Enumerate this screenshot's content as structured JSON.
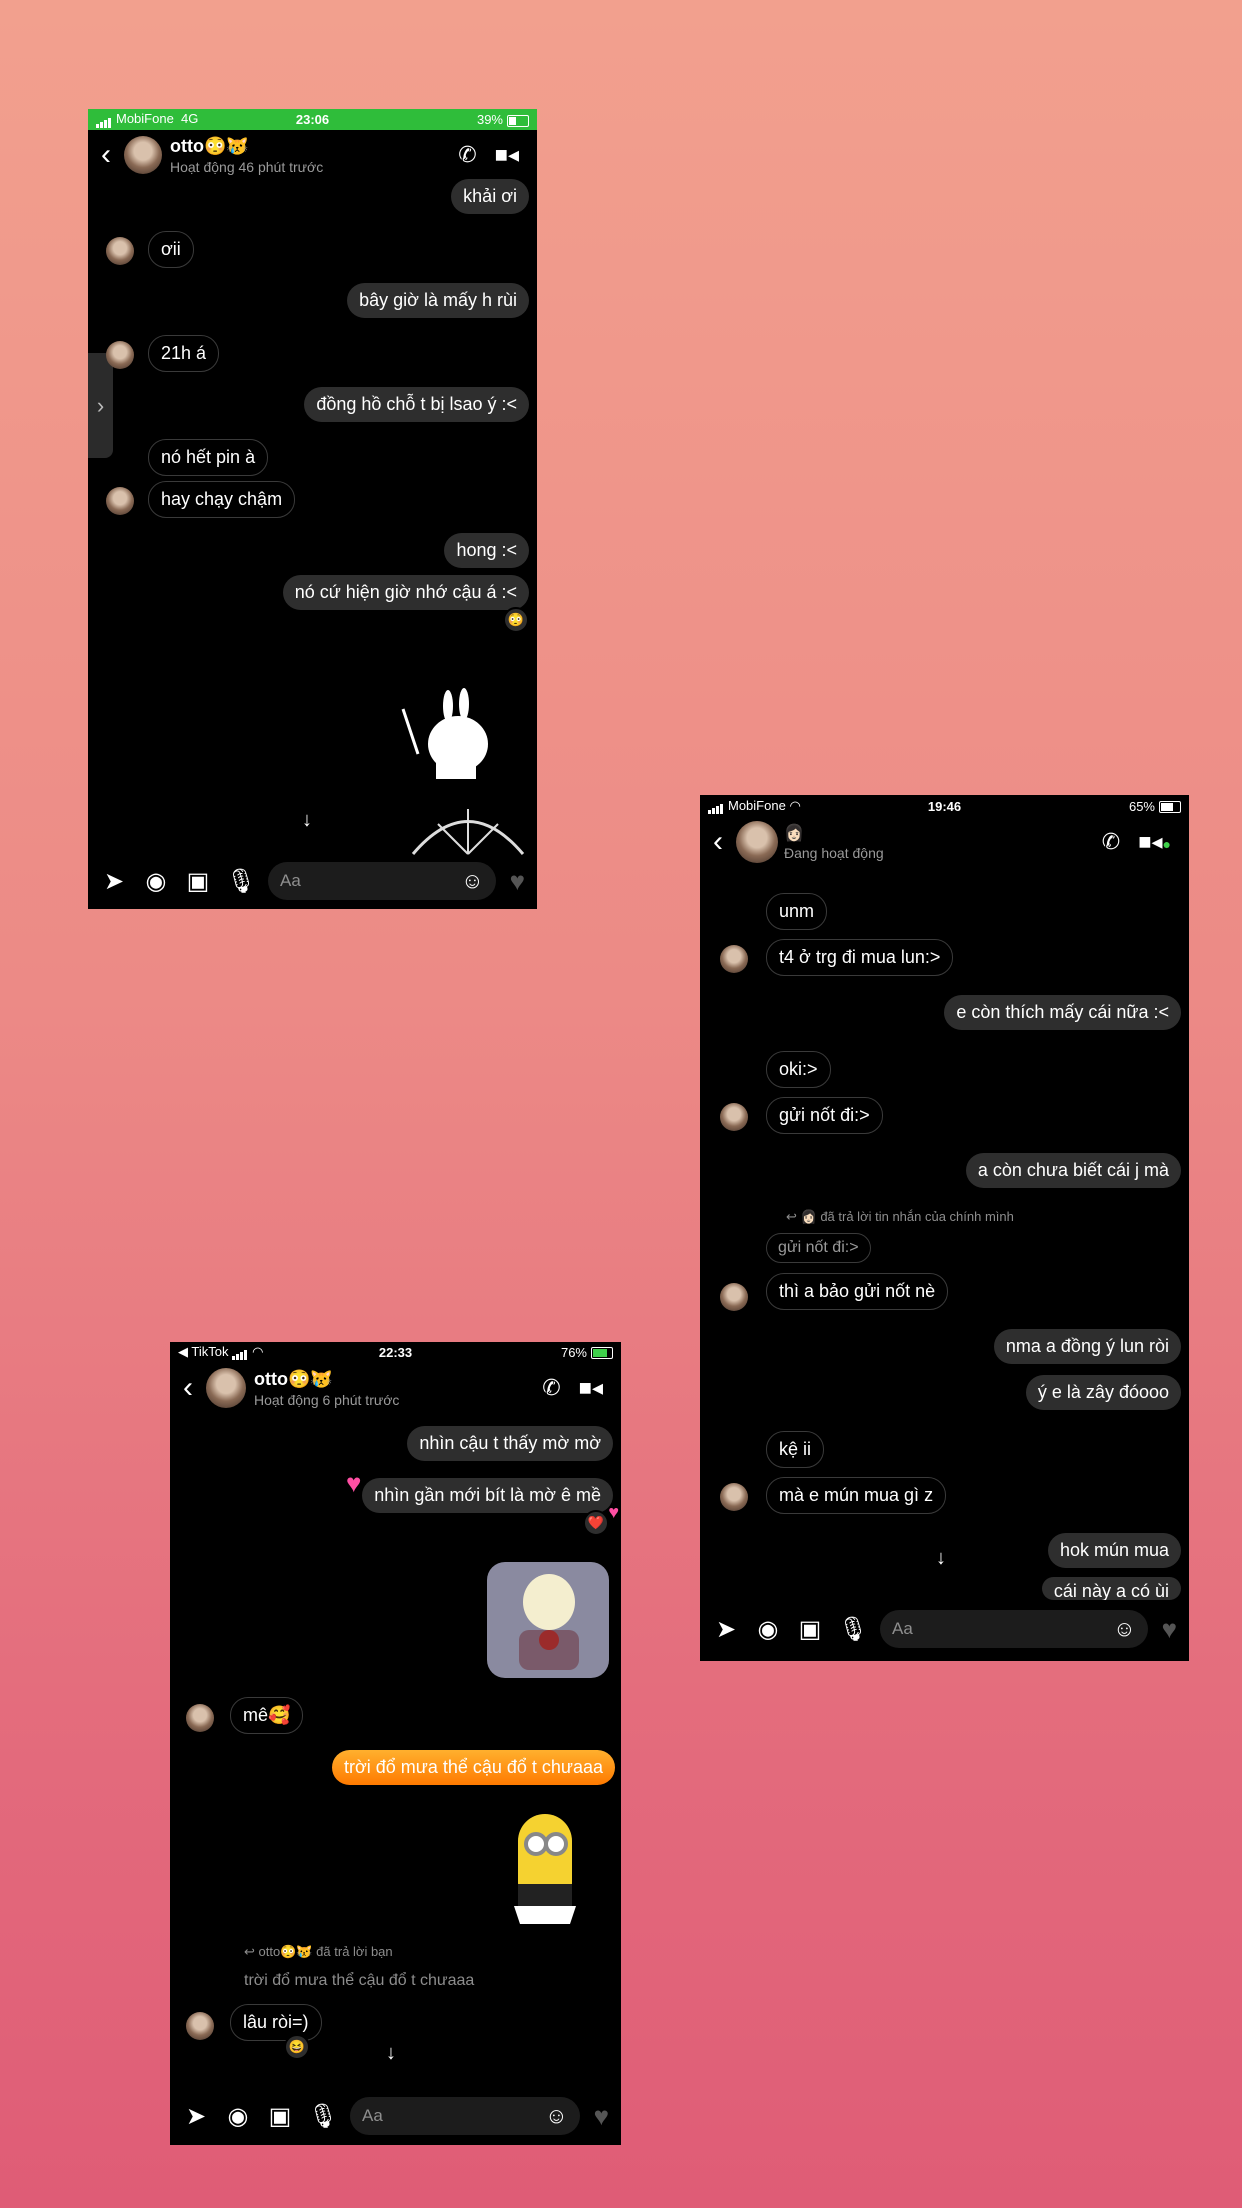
{
  "phone1": {
    "status": {
      "carrier": "MobiFone",
      "network": "4G",
      "time": "23:06",
      "battery": "39%"
    },
    "header": {
      "name": "otto😳😿",
      "subtitle": "Hoạt động 46 phút trước"
    },
    "messages": [
      "khải ơi",
      "ơii",
      "bây giờ là mấy h rùi",
      "21h á",
      "đồng hồ chỗ t bị lsao ý :<",
      "nó hết pin à",
      "hay chạy chậm",
      "hong :<",
      "nó cứ hiện giờ nhớ cậu á :<"
    ],
    "reaction": "😳",
    "composer": {
      "placeholder": "Aa"
    }
  },
  "phone2": {
    "status": {
      "carrier": "MobiFone",
      "time": "19:46",
      "battery": "65%"
    },
    "header": {
      "name_emoji": "👩🏻",
      "subtitle": "Đang hoạt động"
    },
    "messages": [
      "unm",
      "t4 ở trg đi mua lun:>",
      "e còn thích mấy cái nữa :<",
      "oki:>",
      "gửi nốt đi:>",
      "a còn chưa biết cái j mà",
      "gửi nốt đi:>",
      "thì a bảo gửi nốt nè",
      "nma a đồng ý lun ròi",
      "ý e là zây đóooo",
      "kệ ii",
      "mà e mún mua gì z",
      "hok mún mua",
      "cái này a có ùi"
    ],
    "reply_note": "đã trả lời tin nhắn của chính mình",
    "composer": {
      "placeholder": "Aa"
    }
  },
  "phone3": {
    "status": {
      "back_app": "◀ TikTok",
      "time": "22:33",
      "battery": "76%"
    },
    "header": {
      "name": "otto😳😿",
      "subtitle": "Hoạt động 6 phút trước"
    },
    "messages": [
      "nhìn cậu t thấy mờ mờ",
      "nhìn gần mới bít là mờ ê mề",
      "mê🥰",
      "trời đổ mưa thể cậu đổ t chưaaa",
      "lâu ròi=)"
    ],
    "reply_note": "otto😳😿 đã trả lời bạn",
    "quoted": "trời đổ mưa thể cậu đổ t chưaaa",
    "reaction_heart": "❤️",
    "reaction_laugh": "😆",
    "composer": {
      "placeholder": "Aa"
    }
  }
}
